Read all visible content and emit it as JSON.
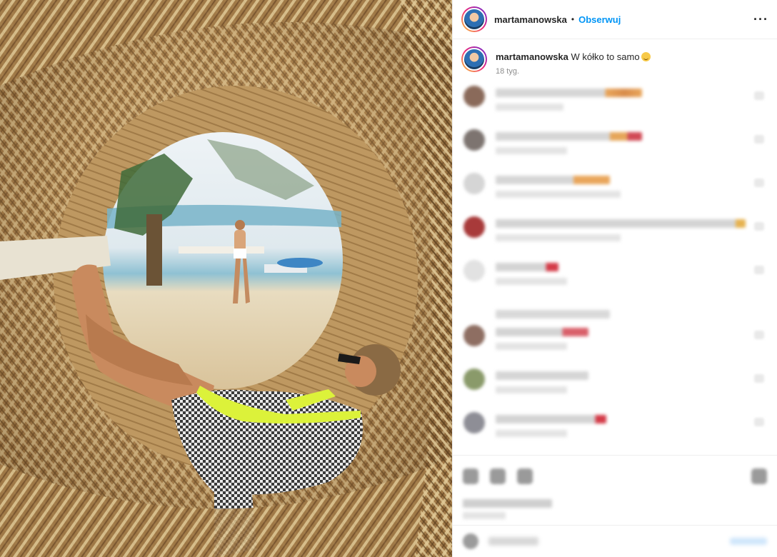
{
  "header": {
    "username": "martamanowska",
    "separator": "•",
    "follow_label": "Obserwuj",
    "more_label": "···"
  },
  "caption": {
    "username": "martamanowska",
    "text": "W kółko to samo",
    "time": "18 tyg."
  },
  "colors": {
    "follow": "#0095f6",
    "text": "#262626",
    "secondary": "#8e8e8e",
    "border": "#efefef"
  },
  "icons": {
    "more": "more-options-icon",
    "like": "heart-icon",
    "comment": "comment-icon",
    "share": "share-icon",
    "save": "bookmark-icon",
    "emoji": "emoji-icon"
  }
}
